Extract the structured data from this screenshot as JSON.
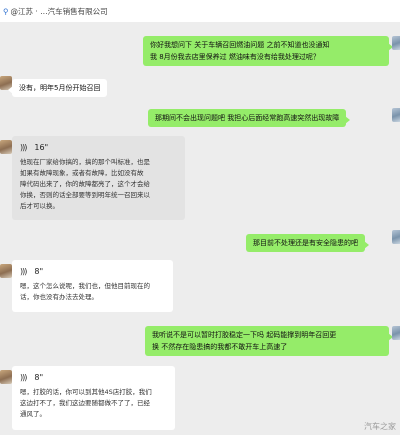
{
  "header": {
    "location_icon": "location-icon",
    "company": "@江苏 · …汽车销售有限公司"
  },
  "messages": {
    "m1": {
      "line1": "你好我想问下 关于车辆召回燃油问题 之前不知道也没通知",
      "line2": "我 8月份我去店里保养过 燃油味有没有给我处理过呢？"
    },
    "m2": {
      "text": "没有，明年5月份开始召回"
    },
    "m3": {
      "text": "那期间不会出现问题吧 我担心后面经常跑高速突然出现故障"
    },
    "m4": {
      "duration": "16\"",
      "transcript": "他现在厂家给你搞的，搞的那个叫标准，也是\n如果有故障现象，或者有故障，比如没有故\n障代码出来了，你的故障都亮了，这个才会给\n你换，否则的话全部要等到明年统一召回来以\n后才可以换。"
    },
    "m5": {
      "text": "那目前不处理还是有安全隐患的吧"
    },
    "m6": {
      "duration": "8\"",
      "transcript": "嗯，这个怎么说呢，我们也，但他目前现在的\n话，你也没有办法去处理。"
    },
    "m7": {
      "line1": "我听说不是可以暂时打胶稳定一下吗  起码能撑到明年召回更",
      "line2": "换 不然存在隐患搞的我都不敢开车上高速了"
    },
    "m8": {
      "duration": "8\"",
      "transcript": "嗯，打胶的话，你可以到其他4S店打胶，我们\n这边打不了，我们这边要随都做不了了，已经\n通风了。"
    }
  },
  "watermark": "汽车之家",
  "colors": {
    "outgoing": "#95ec69",
    "incoming": "#ffffff",
    "voice_card": "#e3e3e3",
    "background": "#ededed"
  }
}
